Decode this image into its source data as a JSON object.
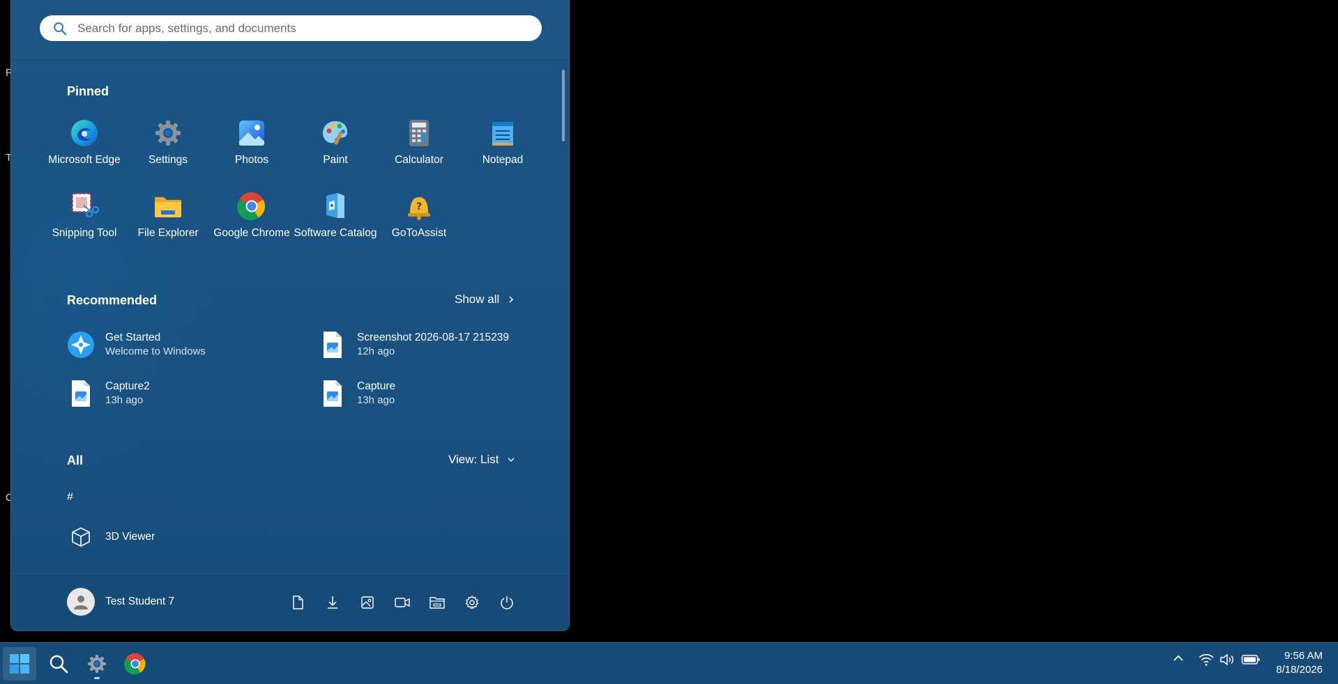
{
  "desktop": {
    "fragments": [
      "R",
      "T",
      "C"
    ]
  },
  "search": {
    "placeholder": "Search for apps, settings, and documents"
  },
  "pinned": {
    "title": "Pinned",
    "items": [
      {
        "label": "Microsoft Edge",
        "icon": "edge-icon"
      },
      {
        "label": "Settings",
        "icon": "gear-icon"
      },
      {
        "label": "Photos",
        "icon": "photos-icon"
      },
      {
        "label": "Paint",
        "icon": "paint-palette-icon"
      },
      {
        "label": "Calculator",
        "icon": "calculator-icon"
      },
      {
        "label": "Notepad",
        "icon": "notepad-icon"
      },
      {
        "label": "Snipping Tool",
        "icon": "snipping-tool-icon"
      },
      {
        "label": "File Explorer",
        "icon": "folder-icon"
      },
      {
        "label": "Google Chrome",
        "icon": "chrome-icon"
      },
      {
        "label": "Software Catalog",
        "icon": "software-catalog-icon"
      },
      {
        "label": "GoToAssist",
        "icon": "gotoassist-icon"
      }
    ]
  },
  "recommended": {
    "title": "Recommended",
    "show_all": "Show all",
    "items": [
      {
        "title": "Get Started",
        "subtitle": "Welcome to Windows",
        "icon": "get-started-icon"
      },
      {
        "title": "Screenshot 2026-08-17 215239",
        "subtitle": "12h ago",
        "icon": "image-file-icon"
      },
      {
        "title": "Capture2",
        "subtitle": "13h ago",
        "icon": "image-file-icon"
      },
      {
        "title": "Capture",
        "subtitle": "13h ago",
        "icon": "image-file-icon"
      }
    ]
  },
  "all": {
    "title": "All",
    "view_label": "View: List",
    "group_header": "#",
    "items": [
      {
        "label": "3D Viewer",
        "icon": "cube-icon"
      }
    ]
  },
  "footer": {
    "user_name": "Test Student 7",
    "buttons": [
      "documents-icon",
      "downloads-icon",
      "pictures-icon",
      "videos-icon",
      "file-explorer-icon",
      "settings-icon",
      "power-icon"
    ]
  },
  "taskbar": {
    "time": "9:56 AM",
    "date": "8/18/2026"
  }
}
